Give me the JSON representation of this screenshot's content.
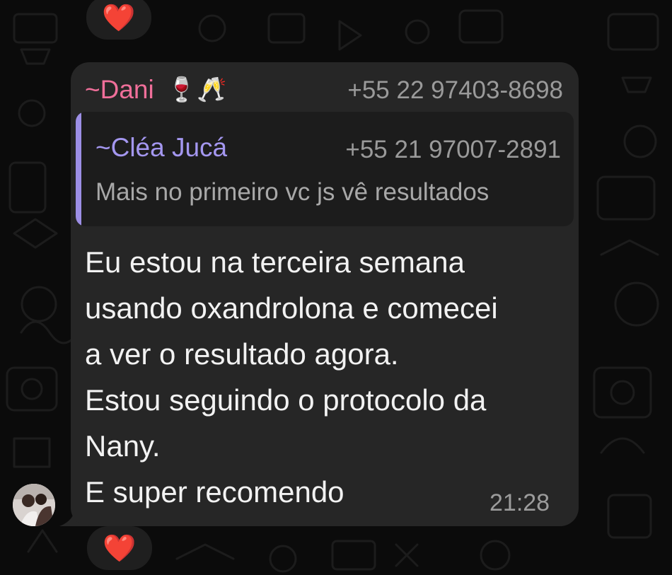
{
  "reactions": {
    "top": "❤️",
    "bottom": "❤️"
  },
  "sender": {
    "name": "~Dani",
    "emoji": "🍷🥂",
    "phone": "+55 22 97403-8698"
  },
  "quote": {
    "name": "~Cléa Jucá",
    "phone": "+55 21 97007-2891",
    "text": "Mais no primeiro vc js vê resultados"
  },
  "message": {
    "lines": [
      "Eu estou na terceira semana",
      "usando oxandrolona e comecei",
      "a ver o resultado agora.",
      "Estou seguindo o protocolo da",
      "Nany.",
      "E super recomendo"
    ]
  },
  "time": "21:28",
  "colors": {
    "background": "#0b0b0b",
    "bubble": "#262626",
    "quote_bg": "#1c1c1c",
    "sender_name": "#f06f9a",
    "quote_name": "#a497f0",
    "quote_bar": "#9d8fe6",
    "heart": "#e5243b"
  }
}
